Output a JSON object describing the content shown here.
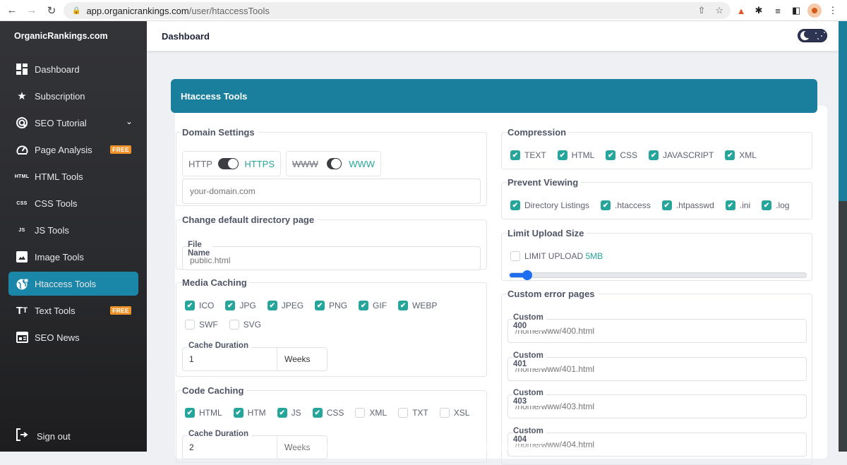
{
  "browser": {
    "url_host": "app.organicrankings.com",
    "url_path": "/user/htaccessTools",
    "icons": [
      "back-icon",
      "forward-icon",
      "reload-icon",
      "lock-icon",
      "share-icon",
      "bookmark-star-icon",
      "extension-lighthouse-icon",
      "extensions-puzzle-icon",
      "reading-list-icon",
      "side-panel-icon",
      "profile-avatar-icon",
      "more-menu-icon"
    ]
  },
  "sidebar": {
    "brand": "OrganicRankings.com",
    "items": [
      {
        "label": "Dashboard",
        "icon": "dashboard-icon"
      },
      {
        "label": "Subscription",
        "icon": "star-icon"
      },
      {
        "label": "SEO Tutorial",
        "icon": "target-click-icon",
        "has_submenu": true
      },
      {
        "label": "Page Analysis",
        "icon": "gauge-icon",
        "badge": "FREE"
      },
      {
        "label": "HTML Tools",
        "icon": "html-icon",
        "icon_text": "HTML"
      },
      {
        "label": "CSS Tools",
        "icon": "css-icon",
        "icon_text": "CSS"
      },
      {
        "label": "JS Tools",
        "icon": "js-icon",
        "icon_text": "JS"
      },
      {
        "label": "Image Tools",
        "icon": "image-icon"
      },
      {
        "label": "Htaccess Tools",
        "icon": "globe-lock-icon",
        "active": true
      },
      {
        "label": "Text Tools",
        "icon": "text-size-icon",
        "badge": "FREE"
      },
      {
        "label": "SEO News",
        "icon": "newspaper-icon"
      }
    ],
    "signout": "Sign out"
  },
  "topbar": {
    "title": "Dashboard",
    "theme": "dark"
  },
  "card": {
    "title": "Htaccess Tools"
  },
  "domain_settings": {
    "legend": "Domain Settings",
    "protocol": {
      "off_label": "HTTP",
      "on_label": "HTTPS",
      "enabled": true
    },
    "www": {
      "off_label": "WWW",
      "on_label": "WWW",
      "enabled": true
    },
    "domain_placeholder": "your-domain.com"
  },
  "directory_page": {
    "legend": "Change default directory page",
    "field_label": "File Name",
    "placeholder": "public.html"
  },
  "media_caching": {
    "legend": "Media Caching",
    "options": [
      {
        "label": "ICO",
        "checked": true
      },
      {
        "label": "JPG",
        "checked": true
      },
      {
        "label": "JPEG",
        "checked": true
      },
      {
        "label": "PNG",
        "checked": true
      },
      {
        "label": "GIF",
        "checked": true
      },
      {
        "label": "WEBP",
        "checked": true
      },
      {
        "label": "SWF",
        "checked": false
      },
      {
        "label": "SVG",
        "checked": false
      }
    ],
    "duration_label": "Cache Duration",
    "duration_value": "1",
    "duration_unit": "Weeks"
  },
  "code_caching": {
    "legend": "Code Caching",
    "options": [
      {
        "label": "HTML",
        "checked": true
      },
      {
        "label": "HTM",
        "checked": true
      },
      {
        "label": "JS",
        "checked": true
      },
      {
        "label": "CSS",
        "checked": true
      },
      {
        "label": "XML",
        "checked": false
      },
      {
        "label": "TXT",
        "checked": false
      },
      {
        "label": "XSL",
        "checked": false
      }
    ],
    "duration_label": "Cache Duration",
    "duration_value": "2",
    "duration_unit": "Weeks"
  },
  "compression": {
    "legend": "Compression",
    "options": [
      {
        "label": "TEXT",
        "checked": true
      },
      {
        "label": "HTML",
        "checked": true
      },
      {
        "label": "CSS",
        "checked": true
      },
      {
        "label": "JAVASCRIPT",
        "checked": true
      },
      {
        "label": "XML",
        "checked": true
      }
    ]
  },
  "prevent_viewing": {
    "legend": "Prevent Viewing",
    "options": [
      {
        "label": "Directory Listings",
        "checked": true
      },
      {
        "label": ".htaccess",
        "checked": true
      },
      {
        "label": ".htpasswd",
        "checked": true
      },
      {
        "label": ".ini",
        "checked": true
      },
      {
        "label": ".log",
        "checked": true
      }
    ]
  },
  "upload_limit": {
    "legend": "Limit Upload Size",
    "checkbox_label": "LIMIT UPLOAD",
    "value_label": "5MB",
    "checked": false,
    "slider_fraction": 0.06
  },
  "error_pages": {
    "legend": "Custom error pages",
    "fields": [
      {
        "label": "Custom 400",
        "placeholder": "/home/www/400.html"
      },
      {
        "label": "Custom 401",
        "placeholder": "/home/www/401.html"
      },
      {
        "label": "Custom 403",
        "placeholder": "/home/www/403.html"
      },
      {
        "label": "Custom 404",
        "placeholder": "/home/www/404.html"
      }
    ]
  },
  "colors": {
    "accent": "#197f9d",
    "check": "#26a69a",
    "badge": "#f0932b",
    "slider": "#1e6ff0"
  }
}
